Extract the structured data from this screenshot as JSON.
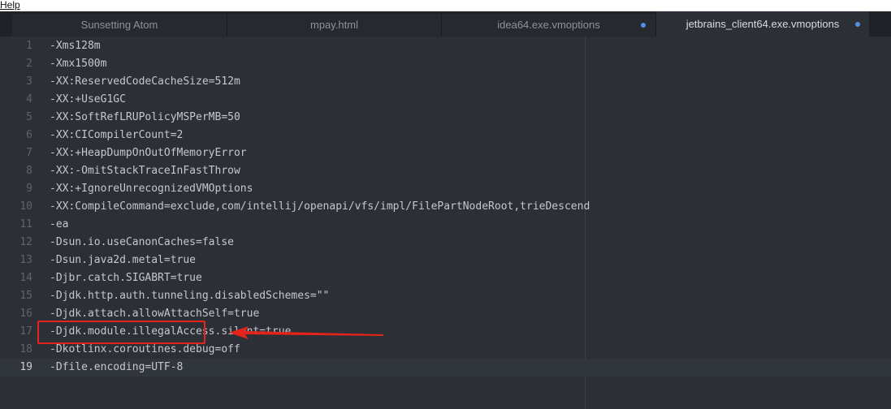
{
  "menubar": {
    "help_label": "Help"
  },
  "tabs": [
    {
      "label": "Sunsetting Atom",
      "modified": false
    },
    {
      "label": "mpay.html",
      "modified": false
    },
    {
      "label": "idea64.exe.vmoptions",
      "modified": true
    },
    {
      "label": "jetbrains_client64.exe.vmoptions",
      "modified": true,
      "active": true
    }
  ],
  "editor": {
    "cursor_line": 19,
    "lines": [
      {
        "n": "1",
        "text": "-Xms128m"
      },
      {
        "n": "2",
        "text": "-Xmx1500m"
      },
      {
        "n": "3",
        "text": "-XX:ReservedCodeCacheSize=512m"
      },
      {
        "n": "4",
        "text": "-XX:+UseG1GC"
      },
      {
        "n": "5",
        "text": "-XX:SoftRefLRUPolicyMSPerMB=50"
      },
      {
        "n": "6",
        "text": "-XX:CICompilerCount=2"
      },
      {
        "n": "7",
        "text": "-XX:+HeapDumpOnOutOfMemoryError"
      },
      {
        "n": "8",
        "text": "-XX:-OmitStackTraceInFastThrow"
      },
      {
        "n": "9",
        "text": "-XX:+IgnoreUnrecognizedVMOptions"
      },
      {
        "n": "10",
        "text": "-XX:CompileCommand=exclude,com/intellij/openapi/vfs/impl/FilePartNodeRoot,trieDescend"
      },
      {
        "n": "11",
        "text": "-ea"
      },
      {
        "n": "12",
        "text": "-Dsun.io.useCanonCaches=false"
      },
      {
        "n": "13",
        "text": "-Dsun.java2d.metal=true"
      },
      {
        "n": "14",
        "text": "-Djbr.catch.SIGABRT=true"
      },
      {
        "n": "15",
        "text": "-Djdk.http.auth.tunneling.disabledSchemes=\"\""
      },
      {
        "n": "16",
        "text": "-Djdk.attach.allowAttachSelf=true"
      },
      {
        "n": "17",
        "text": "-Djdk.module.illegalAccess.silent=true"
      },
      {
        "n": "18",
        "text": "-Dkotlinx.coroutines.debug=off"
      },
      {
        "n": "19",
        "text": "-Dfile.encoding=UTF-8"
      }
    ]
  },
  "colors": {
    "annotation": "#e4231b",
    "modified_dot": "#4f8fe8",
    "editor_bg": "#2c3036"
  }
}
